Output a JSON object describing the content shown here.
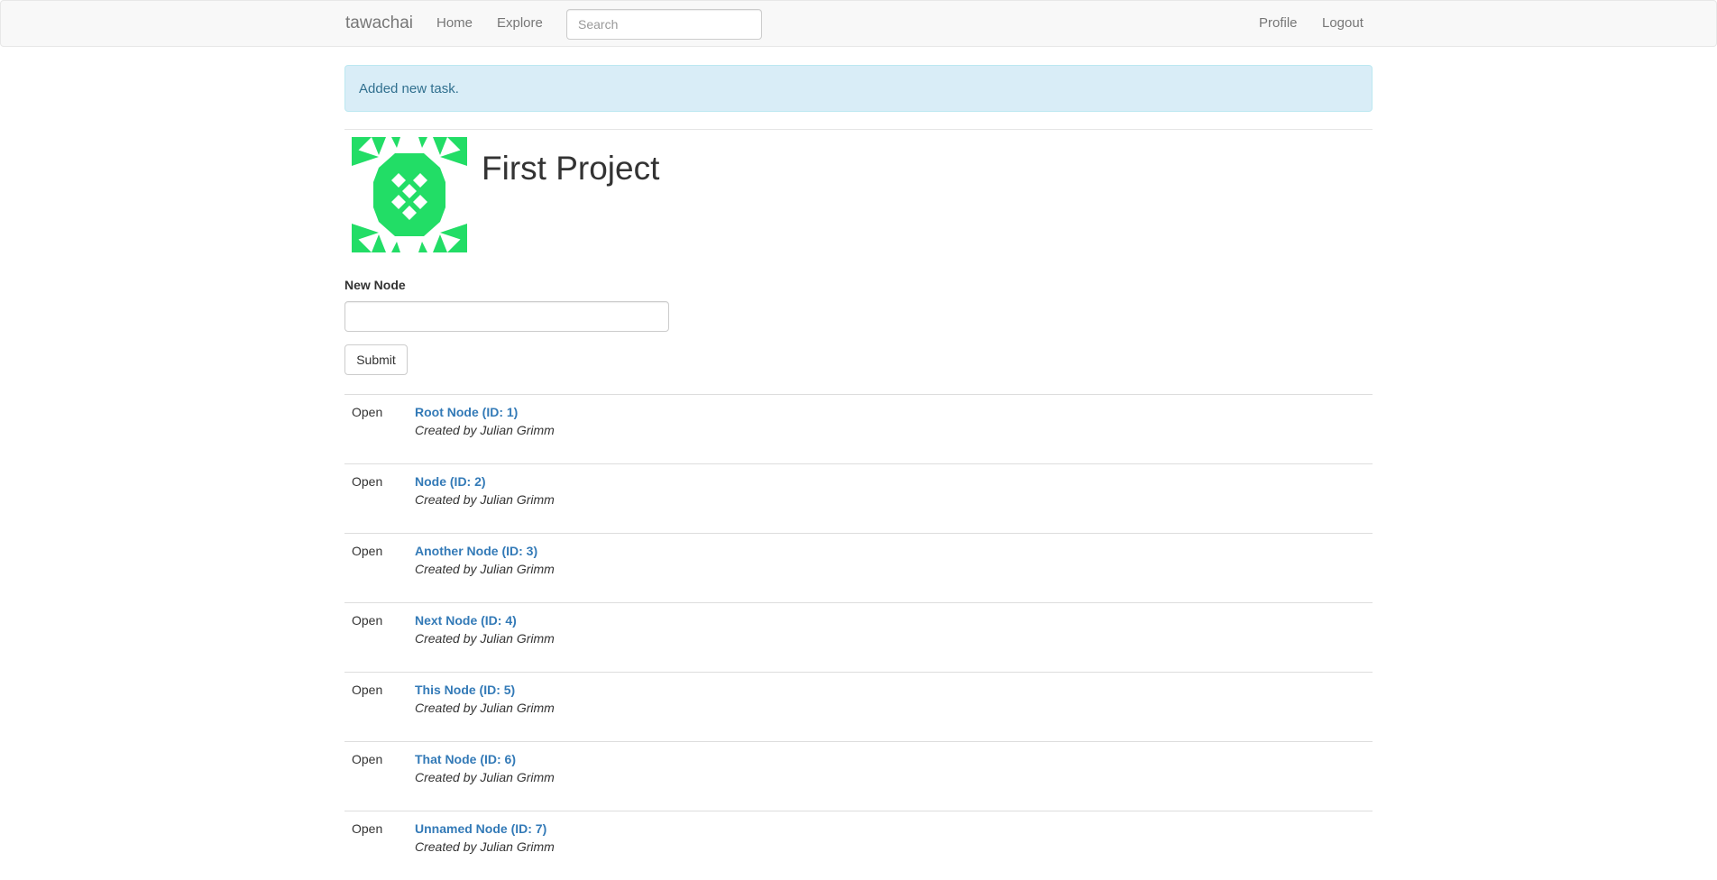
{
  "navbar": {
    "brand": "tawachai",
    "links": [
      "Home",
      "Explore"
    ],
    "search_placeholder": "Search",
    "right_links": [
      "Profile",
      "Logout"
    ]
  },
  "alert": {
    "message": "Added new task."
  },
  "project": {
    "title": "First Project",
    "avatar_color": "#22dd66"
  },
  "form": {
    "label": "New Node",
    "input_value": "",
    "submit_label": "Submit"
  },
  "nodes": [
    {
      "status": "Open",
      "title": "Root Node (ID: 1)",
      "creator": "Created by Julian Grimm"
    },
    {
      "status": "Open",
      "title": "Node (ID: 2)",
      "creator": "Created by Julian Grimm"
    },
    {
      "status": "Open",
      "title": "Another Node (ID: 3)",
      "creator": "Created by Julian Grimm"
    },
    {
      "status": "Open",
      "title": "Next Node (ID: 4)",
      "creator": "Created by Julian Grimm"
    },
    {
      "status": "Open",
      "title": "This Node (ID: 5)",
      "creator": "Created by Julian Grimm"
    },
    {
      "status": "Open",
      "title": "That Node (ID: 6)",
      "creator": "Created by Julian Grimm"
    },
    {
      "status": "Open",
      "title": "Unnamed Node (ID: 7)",
      "creator": "Created by Julian Grimm"
    }
  ]
}
